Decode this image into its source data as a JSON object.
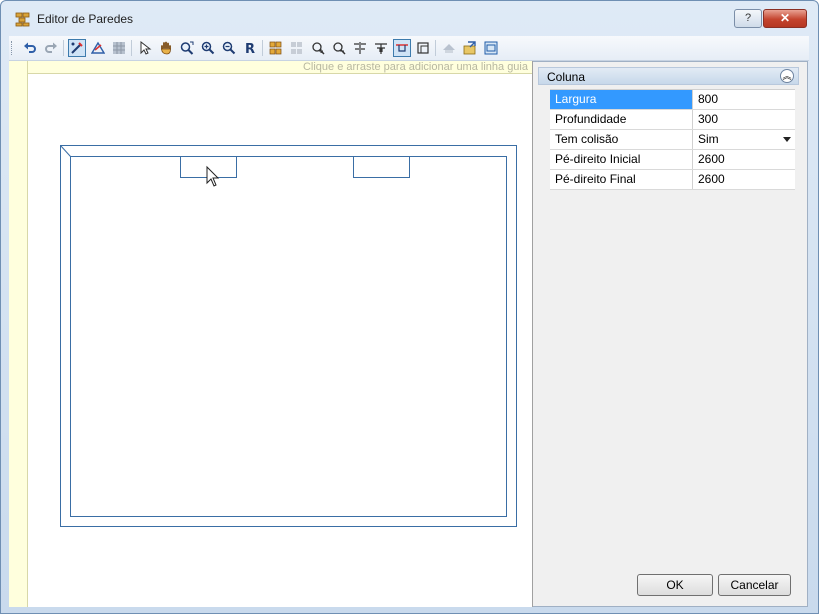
{
  "window": {
    "title": "Editor de Paredes",
    "help_label": "?",
    "close_label": "✕"
  },
  "toolbar": {
    "buttons": [
      {
        "name": "undo",
        "icon": "undo-icon"
      },
      {
        "name": "redo",
        "icon": "redo-icon"
      },
      {
        "name": "draw-wall",
        "icon": "draw-wall-icon",
        "active": true
      },
      {
        "name": "edit-wall",
        "icon": "edit-wall-icon"
      },
      {
        "name": "grid",
        "icon": "grid-icon"
      },
      {
        "name": "select",
        "icon": "pointer-icon"
      },
      {
        "name": "pan",
        "icon": "hand-icon"
      },
      {
        "name": "zoom-window",
        "icon": "zoom-window-icon"
      },
      {
        "name": "zoom-in",
        "icon": "zoom-in-icon"
      },
      {
        "name": "zoom-out",
        "icon": "zoom-out-icon"
      },
      {
        "name": "reset",
        "icon": "reset-icon",
        "label": "R"
      },
      {
        "name": "add-column",
        "icon": "add-column-icon"
      },
      {
        "name": "remove-column",
        "icon": "remove-column-icon"
      },
      {
        "name": "add-point",
        "icon": "add-point-icon"
      },
      {
        "name": "remove-point",
        "icon": "remove-point-icon"
      },
      {
        "name": "align-top",
        "icon": "align-top-icon"
      },
      {
        "name": "align-bottom",
        "icon": "align-bottom-icon"
      },
      {
        "name": "column-tool",
        "icon": "column-tool-icon",
        "active": true
      },
      {
        "name": "corner",
        "icon": "corner-icon"
      },
      {
        "name": "roof",
        "icon": "roof-icon"
      },
      {
        "name": "export",
        "icon": "export-icon"
      },
      {
        "name": "view3d",
        "icon": "view3d-icon"
      }
    ]
  },
  "canvas": {
    "guide_hint": "Clique e arraste para adicionar uma linha guia"
  },
  "properties": {
    "group_title": "Coluna",
    "rows": [
      {
        "label": "Largura",
        "value": "800",
        "selected": true
      },
      {
        "label": "Profundidade",
        "value": "300"
      },
      {
        "label": "Tem colisão",
        "value": "Sim",
        "dropdown": true
      },
      {
        "label": "Pé-direito Inicial",
        "value": "2600"
      },
      {
        "label": "Pé-direito Final",
        "value": "2600"
      }
    ]
  },
  "buttons": {
    "ok": "OK",
    "cancel": "Cancelar"
  },
  "colors": {
    "wall_stroke": "#3a6ea5",
    "selected_row": "#3399ff",
    "ruler": "#ffffdd"
  }
}
